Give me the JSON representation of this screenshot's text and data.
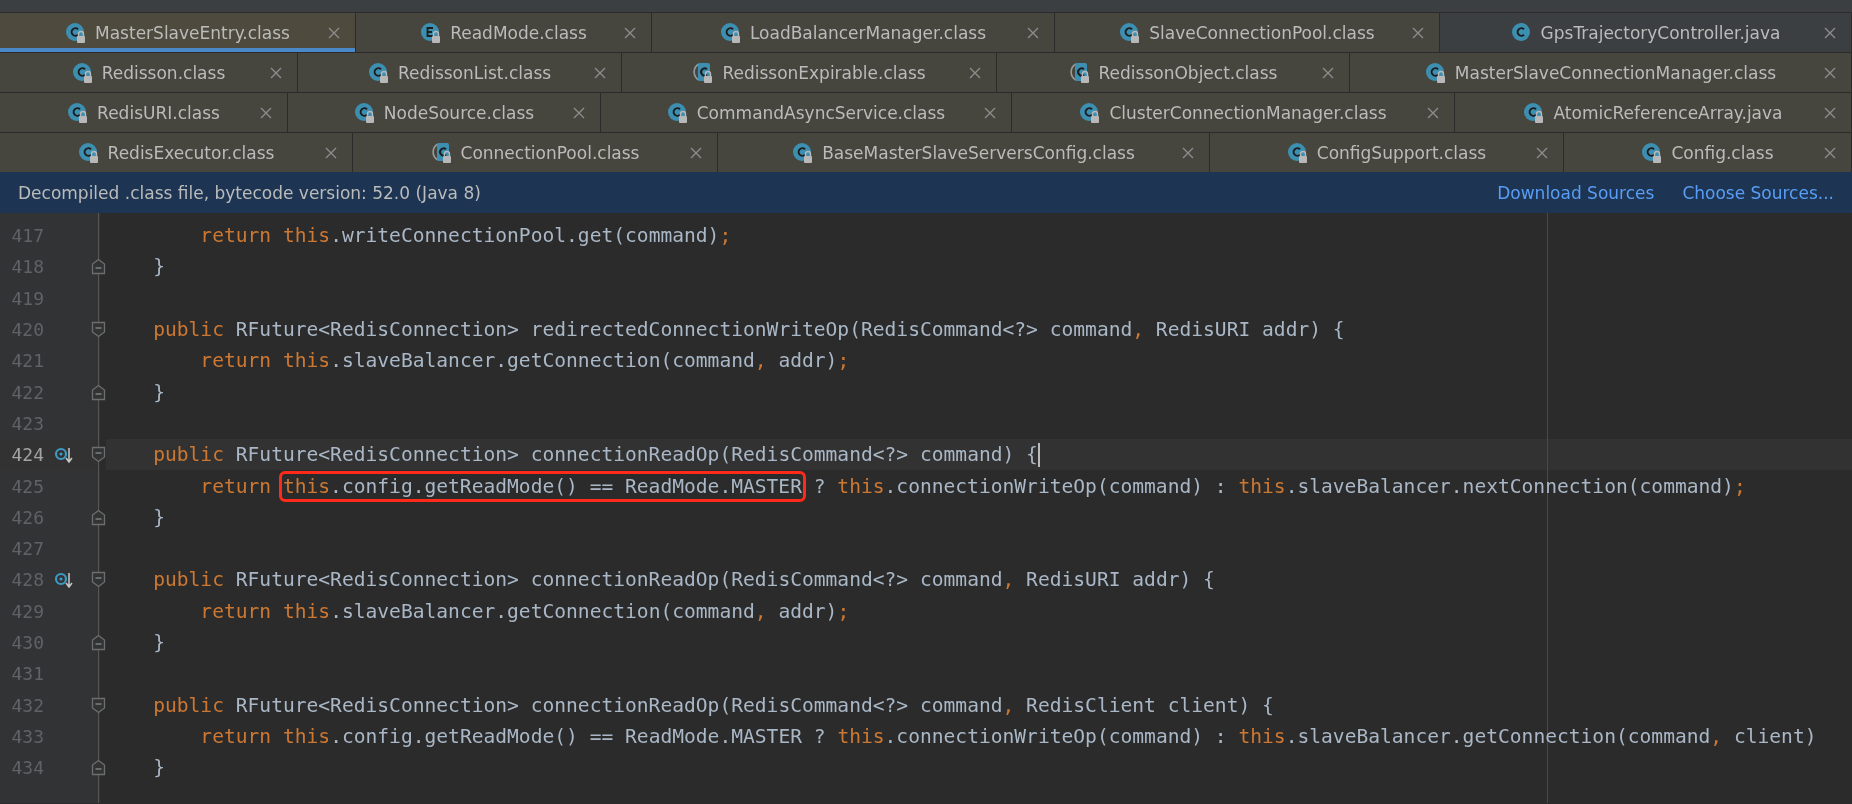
{
  "tab_rows": [
    [
      {
        "label": "MasterSlaveEntry.class",
        "kind": "class",
        "locked": true,
        "selected": true
      },
      {
        "label": "ReadMode.class",
        "kind": "enum",
        "locked": true,
        "selected": false
      },
      {
        "label": "LoadBalancerManager.class",
        "kind": "class",
        "locked": true,
        "selected": false
      },
      {
        "label": "SlaveConnectionPool.class",
        "kind": "class",
        "locked": true,
        "selected": false
      },
      {
        "label": "GpsTrajectoryController.java",
        "kind": "class",
        "locked": false,
        "selected": false
      }
    ],
    [
      {
        "label": "Redisson.class",
        "kind": "class",
        "locked": true,
        "selected": false
      },
      {
        "label": "RedissonList.class",
        "kind": "class",
        "locked": true,
        "selected": false
      },
      {
        "label": "RedissonExpirable.class",
        "kind": "abstract",
        "locked": true,
        "selected": false
      },
      {
        "label": "RedissonObject.class",
        "kind": "abstract",
        "locked": true,
        "selected": false
      },
      {
        "label": "MasterSlaveConnectionManager.class",
        "kind": "class",
        "locked": true,
        "selected": false
      }
    ],
    [
      {
        "label": "RedisURI.class",
        "kind": "class",
        "locked": true,
        "selected": false
      },
      {
        "label": "NodeSource.class",
        "kind": "class",
        "locked": true,
        "selected": false
      },
      {
        "label": "CommandAsyncService.class",
        "kind": "class",
        "locked": true,
        "selected": false
      },
      {
        "label": "ClusterConnectionManager.class",
        "kind": "class",
        "locked": true,
        "selected": false
      },
      {
        "label": "AtomicReferenceArray.java",
        "kind": "class",
        "locked": true,
        "selected": false
      }
    ],
    [
      {
        "label": "RedisExecutor.class",
        "kind": "class",
        "locked": true,
        "selected": false
      },
      {
        "label": "ConnectionPool.class",
        "kind": "abstract",
        "locked": true,
        "selected": false
      },
      {
        "label": "BaseMasterSlaveServersConfig.class",
        "kind": "class",
        "locked": true,
        "selected": false
      },
      {
        "label": "ConfigSupport.class",
        "kind": "class",
        "locked": true,
        "selected": false
      },
      {
        "label": "Config.class",
        "kind": "class",
        "locked": true,
        "selected": false
      }
    ]
  ],
  "notice_bar": {
    "message": "Decompiled .class file, bytecode version: 52.0 (Java 8)",
    "links": [
      "Download Sources",
      "Choose Sources..."
    ]
  },
  "editor": {
    "lines": [
      {
        "number": "417",
        "kind": "statement",
        "tokens": [
          {
            "kind": "keyword",
            "text": "return this"
          },
          {
            "kind": "plain",
            "text": ".writeConnectionPool.get(command)"
          },
          {
            "kind": "keyword",
            "text": ";"
          }
        ]
      },
      {
        "number": "418",
        "kind": "closing",
        "tokens": [
          {
            "kind": "plain",
            "text": "}"
          }
        ]
      },
      {
        "number": "419",
        "kind": "blank"
      },
      {
        "number": "420",
        "kind": "signature",
        "tokens": [
          {
            "kind": "keyword",
            "text": "public"
          },
          {
            "kind": "plain",
            "text": " RFuture<RedisConnection> redirectedConnectionWriteOp(RedisCommand<?> command"
          },
          {
            "kind": "keyword",
            "text": ","
          },
          {
            "kind": "plain",
            "text": " RedisURI addr) {"
          }
        ]
      },
      {
        "number": "421",
        "kind": "statement",
        "tokens": [
          {
            "kind": "keyword",
            "text": "return this"
          },
          {
            "kind": "plain",
            "text": ".slaveBalancer.getConnection(command"
          },
          {
            "kind": "keyword",
            "text": ","
          },
          {
            "kind": "plain",
            "text": " addr)"
          },
          {
            "kind": "keyword",
            "text": ";"
          }
        ]
      },
      {
        "number": "422",
        "kind": "closing",
        "tokens": [
          {
            "kind": "plain",
            "text": "}"
          }
        ]
      },
      {
        "number": "423",
        "kind": "blank"
      },
      {
        "number": "424",
        "kind": "signature",
        "override": true,
        "current": true,
        "tokens": [
          {
            "kind": "keyword",
            "text": "public"
          },
          {
            "kind": "plain",
            "text": " RFuture<RedisConnection> connectionReadOp(RedisCommand<?> command) {"
          }
        ]
      },
      {
        "number": "425",
        "kind": "statement",
        "tokens": [
          {
            "kind": "keyword",
            "text": "return"
          },
          {
            "kind": "box",
            "tokens": [
              {
                "kind": "keyword",
                "text": "this"
              },
              {
                "kind": "plain",
                "text": ".config.getReadMode() == ReadMode.MASTER"
              }
            ]
          },
          {
            "kind": "plain",
            "text": " ? "
          },
          {
            "kind": "keyword",
            "text": "this"
          },
          {
            "kind": "plain",
            "text": ".connectionWriteOp(command) : "
          },
          {
            "kind": "keyword",
            "text": "this"
          },
          {
            "kind": "plain",
            "text": ".slaveBalancer.nextConnection(command)"
          },
          {
            "kind": "keyword",
            "text": ";"
          }
        ]
      },
      {
        "number": "426",
        "kind": "closing",
        "tokens": [
          {
            "kind": "plain",
            "text": "}"
          }
        ]
      },
      {
        "number": "427",
        "kind": "blank"
      },
      {
        "number": "428",
        "kind": "signature",
        "override": true,
        "tokens": [
          {
            "kind": "keyword",
            "text": "public"
          },
          {
            "kind": "plain",
            "text": " RFuture<RedisConnection> connectionReadOp(RedisCommand<?> command"
          },
          {
            "kind": "keyword",
            "text": ","
          },
          {
            "kind": "plain",
            "text": " RedisURI addr) {"
          }
        ]
      },
      {
        "number": "429",
        "kind": "statement",
        "tokens": [
          {
            "kind": "keyword",
            "text": "return this"
          },
          {
            "kind": "plain",
            "text": ".slaveBalancer.getConnection(command"
          },
          {
            "kind": "keyword",
            "text": ","
          },
          {
            "kind": "plain",
            "text": " addr)"
          },
          {
            "kind": "keyword",
            "text": ";"
          }
        ]
      },
      {
        "number": "430",
        "kind": "closing",
        "tokens": [
          {
            "kind": "plain",
            "text": "}"
          }
        ]
      },
      {
        "number": "431",
        "kind": "blank"
      },
      {
        "number": "432",
        "kind": "signature",
        "tokens": [
          {
            "kind": "keyword",
            "text": "public"
          },
          {
            "kind": "plain",
            "text": " RFuture<RedisConnection> connectionReadOp(RedisCommand<?> command"
          },
          {
            "kind": "keyword",
            "text": ","
          },
          {
            "kind": "plain",
            "text": " RedisClient client) {"
          }
        ]
      },
      {
        "number": "433",
        "kind": "statement",
        "tokens": [
          {
            "kind": "keyword",
            "text": "return this"
          },
          {
            "kind": "plain",
            "text": ".config.getReadMode() == ReadMode.MASTER ? "
          },
          {
            "kind": "keyword",
            "text": "this"
          },
          {
            "kind": "plain",
            "text": ".connectionWriteOp(command) : "
          },
          {
            "kind": "keyword",
            "text": "this"
          },
          {
            "kind": "plain",
            "text": ".slaveBalancer.getConnection(command"
          },
          {
            "kind": "keyword",
            "text": ","
          },
          {
            "kind": "plain",
            "text": " client)"
          }
        ]
      },
      {
        "number": "434",
        "kind": "closing",
        "tokens": [
          {
            "kind": "plain",
            "text": "}"
          }
        ]
      }
    ]
  }
}
